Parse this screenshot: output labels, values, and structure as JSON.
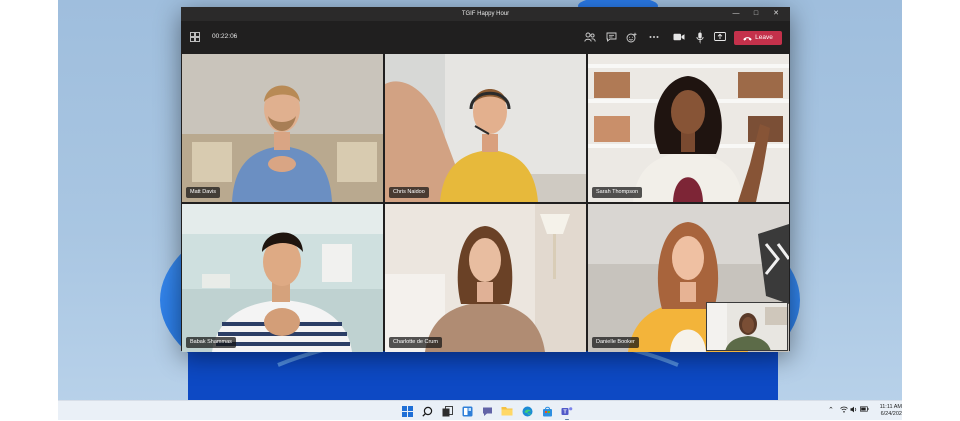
{
  "window": {
    "title": "TGIF Happy Hour"
  },
  "toolbar": {
    "call_timer": "00:22:06",
    "leave_label": "Leave",
    "icons": [
      "grid-view-icon",
      "people-icon",
      "chat-icon",
      "reactions-icon",
      "more-options-icon",
      "camera-icon",
      "microphone-icon",
      "share-screen-icon",
      "phone-hangup-icon"
    ]
  },
  "participants": [
    {
      "name": "Matt Davis"
    },
    {
      "name": "Chris Naidoo"
    },
    {
      "name": "Sarah Thompson"
    },
    {
      "name": "Babak Shammas"
    },
    {
      "name": "Charlotte de Crum"
    },
    {
      "name": "Danielle Booker"
    }
  ],
  "taskbar": {
    "apps": [
      "start-icon",
      "search-icon",
      "task-view-icon",
      "widgets-icon",
      "chat-icon",
      "file-explorer-icon",
      "edge-icon",
      "store-icon",
      "teams-icon"
    ],
    "clock_time": "11:11 AM",
    "clock_date": "6/24/202"
  },
  "colors": {
    "leave_button": "#c4314b",
    "window_bg": "#201f1f",
    "desktop": "#a9c6e2"
  }
}
